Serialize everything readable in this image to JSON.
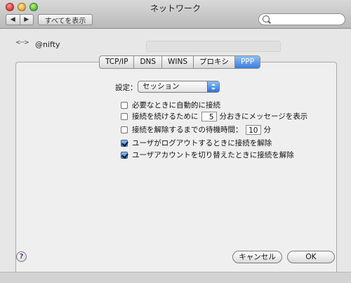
{
  "window": {
    "title": "ネットワーク"
  },
  "toolbar": {
    "back": "◀",
    "forward": "▶",
    "show_all": "すべてを表示",
    "search_placeholder": ""
  },
  "connection": {
    "name": "@nifty"
  },
  "tabs": [
    {
      "label": "TCP/IP",
      "active": false
    },
    {
      "label": "DNS",
      "active": false
    },
    {
      "label": "WINS",
      "active": false
    },
    {
      "label": "プロキシ",
      "active": false
    },
    {
      "label": "PPP",
      "active": true
    }
  ],
  "settings": {
    "label": "設定：",
    "selected": "セッション"
  },
  "options": {
    "auto_connect": {
      "label": "必要なときに自動的に接続",
      "checked": false
    },
    "keepalive": {
      "prefix": "接続を続けるために",
      "value": "5",
      "suffix": "分おきにメッセージを表示",
      "checked": false
    },
    "idle": {
      "prefix": "接続を解除するまでの待機時間：",
      "value": "10",
      "suffix": "分",
      "checked": false
    },
    "logout": {
      "label": "ユーザがログアウトするときに接続を解除",
      "checked": true
    },
    "switch_user": {
      "label": "ユーザアカウントを切り替えたときに接続を解除",
      "checked": true
    }
  },
  "footer": {
    "help": "?",
    "cancel": "キャンセル",
    "ok": "OK"
  }
}
